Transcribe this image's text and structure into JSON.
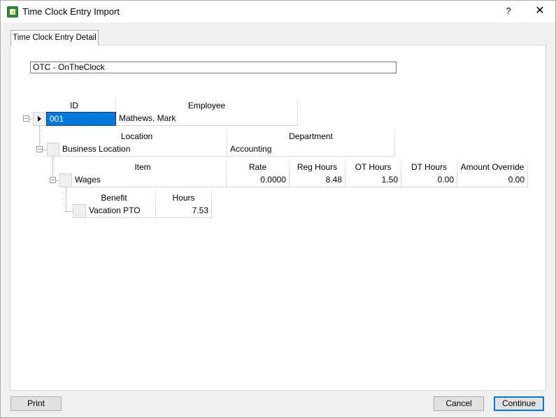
{
  "window": {
    "title": "Time Clock Entry Import",
    "help_label": "?",
    "close_label": "✕"
  },
  "tabs": [
    {
      "label": "Time Clock Entry Detail",
      "active": true
    }
  ],
  "source": {
    "value": "OTC - OnTheClock"
  },
  "employee_grid": {
    "columns": [
      "ID",
      "Employee"
    ],
    "rows": [
      {
        "id": "001",
        "employee": "Mathews, Mark"
      }
    ]
  },
  "location_grid": {
    "columns": [
      "Location",
      "Department"
    ],
    "rows": [
      {
        "location": "Business Location",
        "department": "Accounting"
      }
    ]
  },
  "item_grid": {
    "columns": [
      "Item",
      "Rate",
      "Reg Hours",
      "OT Hours",
      "DT Hours",
      "Amount Override"
    ],
    "rows": [
      {
        "item": "Wages",
        "rate": "0.0000",
        "reg_hours": "8.48",
        "ot_hours": "1.50",
        "dt_hours": "0.00",
        "amount_override": "0.00"
      }
    ]
  },
  "benefit_grid": {
    "columns": [
      "Benefit",
      "Hours"
    ],
    "rows": [
      {
        "benefit": "Vacation PTO",
        "hours": "7.53"
      }
    ]
  },
  "buttons": {
    "print": "Print",
    "cancel": "Cancel",
    "continue": "Continue"
  },
  "colors": {
    "selection": "#0078d7",
    "app_icon": "#2e8b3a"
  },
  "icons": [
    "app-icon",
    "help-icon",
    "close-icon",
    "row-pointer-icon",
    "collapse-icon"
  ]
}
